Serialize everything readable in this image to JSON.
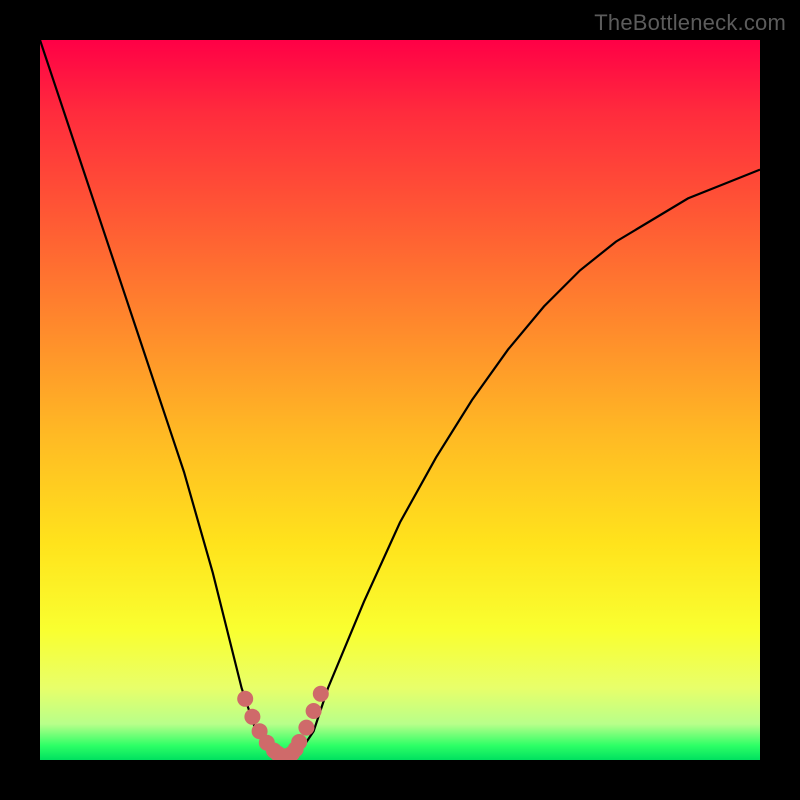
{
  "watermark": "TheBottleneck.com",
  "chart_data": {
    "type": "line",
    "title": "",
    "xlabel": "",
    "ylabel": "",
    "xlim": [
      0,
      100
    ],
    "ylim": [
      0,
      100
    ],
    "grid": false,
    "series": [
      {
        "name": "bottleneck-curve",
        "x": [
          0,
          2,
          4,
          6,
          8,
          10,
          12,
          14,
          16,
          18,
          20,
          22,
          24,
          26,
          28,
          30,
          32,
          34,
          36,
          38,
          40,
          45,
          50,
          55,
          60,
          65,
          70,
          75,
          80,
          85,
          90,
          95,
          100
        ],
        "y": [
          100,
          94,
          88,
          82,
          76,
          70,
          64,
          58,
          52,
          46,
          40,
          33,
          26,
          18,
          10,
          4,
          1,
          0,
          1,
          4,
          10,
          22,
          33,
          42,
          50,
          57,
          63,
          68,
          72,
          75,
          78,
          80,
          82
        ]
      }
    ],
    "highlight": {
      "name": "near-minimum-markers",
      "color": "#cf6a6a",
      "x": [
        28.5,
        29.5,
        30.5,
        31.5,
        32.5,
        33.0,
        33.5,
        34.0,
        34.5,
        35.0,
        35.5,
        36.0,
        37.0,
        38.0,
        39.0
      ],
      "y": [
        8.5,
        6.0,
        4.0,
        2.4,
        1.3,
        0.9,
        0.6,
        0.5,
        0.6,
        0.9,
        1.5,
        2.5,
        4.5,
        6.8,
        9.2
      ]
    }
  }
}
